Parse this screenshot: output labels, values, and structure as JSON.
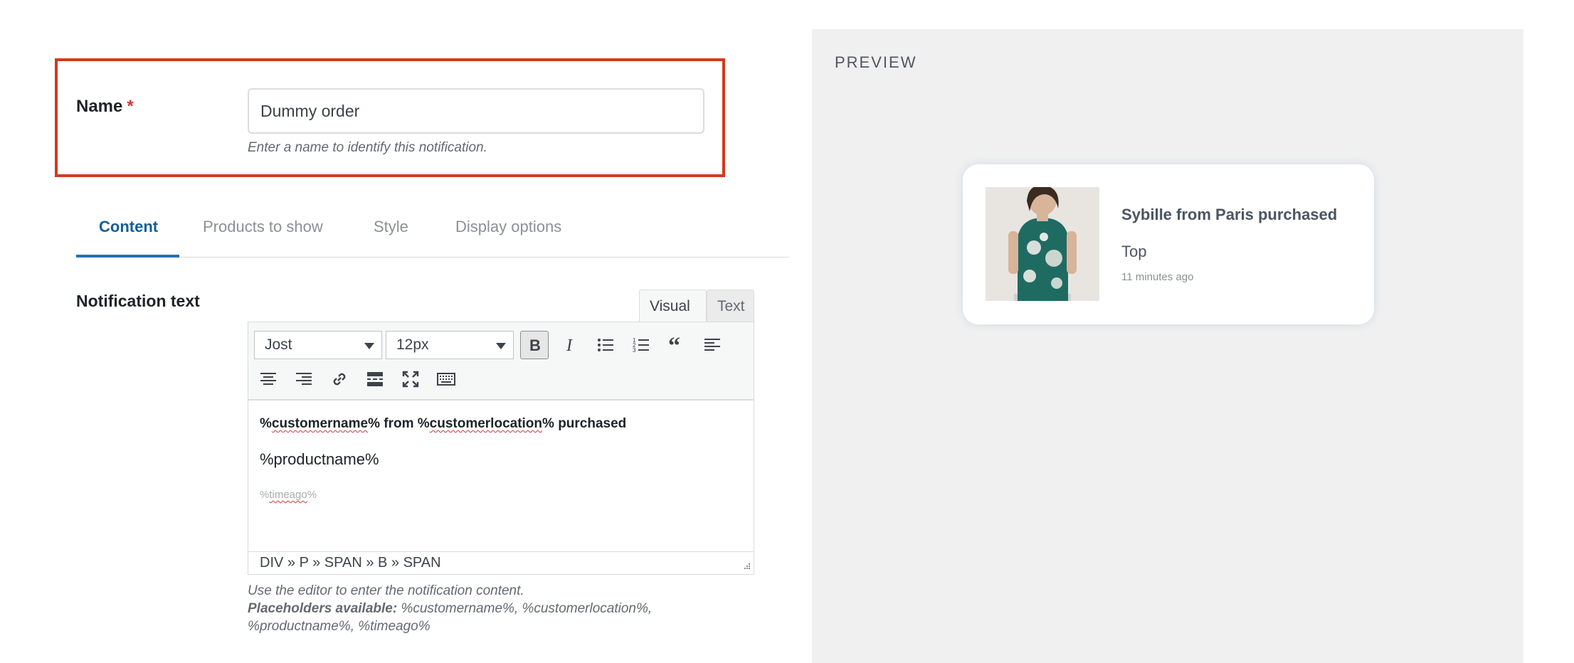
{
  "name_field": {
    "label": "Name",
    "required_mark": "*",
    "value": "Dummy order",
    "help": "Enter a name to identify this notification."
  },
  "tabs": [
    {
      "label": "Content",
      "active": true
    },
    {
      "label": "Products to show",
      "active": false
    },
    {
      "label": "Style",
      "active": false
    },
    {
      "label": "Display options",
      "active": false
    }
  ],
  "notification": {
    "label": "Notification text",
    "mode_visual": "Visual",
    "mode_text": "Text",
    "font_select": "Jost",
    "size_select": "12px",
    "toolbar_icons": [
      "bold-icon",
      "italic-icon",
      "bullet-list-icon",
      "numbered-list-icon",
      "blockquote-icon",
      "align-left-icon",
      "align-center-icon",
      "align-right-icon",
      "link-icon",
      "read-more-icon",
      "fullscreen-icon",
      "keyboard-icon"
    ],
    "content": {
      "line1_parts": [
        "%",
        "customername",
        "% from %",
        "customerlocation",
        "% purchased"
      ],
      "line2": "%productname%",
      "line3_parts": [
        "%",
        "timeago",
        "%"
      ]
    },
    "path": "DIV » P » SPAN » B » SPAN",
    "help_line1": "Use the editor to enter the notification content.",
    "help_placeholders_label": "Placeholders available:",
    "help_placeholders": " %customername%, %customerlocation%, %productname%, %timeago%"
  },
  "preview": {
    "title": "PREVIEW",
    "card": {
      "headline": "Sybille from Paris purchased",
      "product": "Top",
      "time": "11 minutes ago"
    }
  },
  "colors": {
    "highlight_border": "#d23a1d",
    "accent": "#2271b1",
    "required": "#d63638",
    "preview_bg": "#f0f0f0"
  }
}
